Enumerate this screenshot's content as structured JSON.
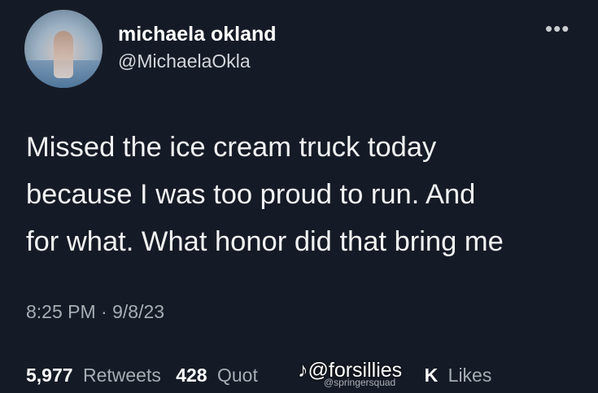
{
  "user": {
    "display_name": "michaela okland",
    "handle": "@MichaelaOkla"
  },
  "more_icon": "more-icon",
  "tweet": {
    "lines": [
      "Missed the ice cream truck today",
      "because I was too proud to run. And",
      "for what. What honor did that bring me"
    ],
    "time": "8:25 PM",
    "separator": "·",
    "date": "9/8/23"
  },
  "stats": {
    "retweets_count": "5,977",
    "retweets_label": "Retweets",
    "quotes_count": "428",
    "quotes_label_partial": "Quot",
    "likes_count_partial": "K",
    "likes_label": "Likes"
  },
  "watermark": {
    "main": "@forsillies",
    "secondary": "@springersquad"
  }
}
